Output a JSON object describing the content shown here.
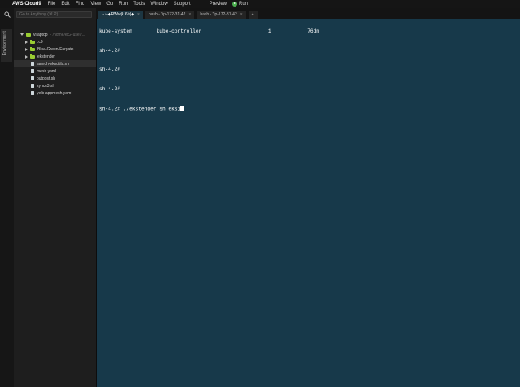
{
  "menubar": {
    "brand": "AWS Cloud9",
    "items": [
      "File",
      "Edit",
      "Find",
      "View",
      "Go",
      "Run",
      "Tools",
      "Window",
      "Support"
    ],
    "preview": "Preview",
    "run": "Run"
  },
  "sidebar": {
    "rail_label": "Environment",
    "goto_placeholder": "Go to Anything (⌘ P)",
    "tree": [
      {
        "label": "vl.aptop",
        "suffix": "- /home/ec2-user/..."
      },
      {
        "label": ".c9"
      },
      {
        "label": "Blue-Green-Fargate"
      },
      {
        "label": "ekstender"
      },
      {
        "label": "launch-eksutils.sh"
      },
      {
        "label": "mesh.yaml"
      },
      {
        "label": "outpost.sh"
      },
      {
        "label": "syncs3.sh"
      },
      {
        "label": "yelb-appmesh.yaml"
      }
    ]
  },
  "tabs": [
    {
      "label": ":- ⁿ-◆RWw|k.6,ʰ|◆",
      "close": "×"
    },
    {
      "label": "bash - \"ip-172-31-42",
      "close": "×"
    },
    {
      "label": "bash - \"ip-172-31-42",
      "close": "×"
    },
    {
      "label": "+"
    }
  ],
  "terminal": {
    "lines": [
      "kube-system        kube-controller                      1            76dm",
      "sh-4.2#",
      "sh-4.2#",
      "sh-4.2#",
      "sh-4.2# ./ekstender.sh eks1"
    ]
  },
  "colors": {
    "terminal_bg": "#17394a",
    "run_accent": "#4caf50",
    "folder_icon": "#9acd32"
  }
}
